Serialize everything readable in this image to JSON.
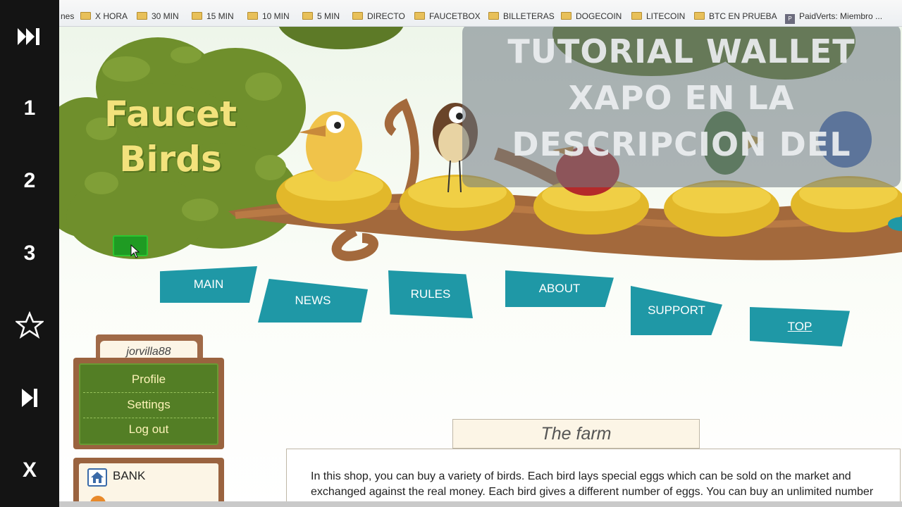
{
  "rail": {
    "items": [
      {
        "name": "fast-forward-icon",
        "glyph": "⏭"
      },
      {
        "name": "rail-item-1",
        "label": "1"
      },
      {
        "name": "rail-item-2",
        "label": "2"
      },
      {
        "name": "rail-item-3",
        "label": "3"
      },
      {
        "name": "star-icon",
        "glyph": "☆"
      },
      {
        "name": "next-icon",
        "glyph": "⏭"
      },
      {
        "name": "close-icon",
        "glyph": "X"
      }
    ]
  },
  "bookmarks": {
    "items": [
      "nes",
      "X HORA",
      "30 MIN",
      "15 MIN",
      "10 MIN",
      "5 MIN",
      "DIRECTO",
      "FAUCETBOX",
      "BILLETERAS",
      "DOGECOIN",
      "LITECOIN",
      "BTC EN PRUEBA",
      "PaidVerts: Miembro ..."
    ]
  },
  "overlay": {
    "lines": [
      "TUTORIAL WALLET",
      "XAPO EN LA",
      "DESCRIPCION DEL"
    ]
  },
  "logo": {
    "line1": "Faucet",
    "line2": "Birds"
  },
  "nav": {
    "main": "MAIN",
    "news": "NEWS",
    "rules": "RULES",
    "about": "ABOUT",
    "support": "SUPPORT",
    "top": "TOP"
  },
  "user": {
    "name": "jorvilla88",
    "menu": [
      "Profile",
      "Settings",
      "Log out"
    ]
  },
  "bank": {
    "label": "BANK"
  },
  "farm": {
    "title": "The farm",
    "text": "In this shop, you can buy a variety of birds. Each bird lays special eggs which can be sold on the market and exchanged against the real money. Each bird gives a different number of eggs. You can buy an unlimited number of times, our magical birds do not die (if you keep feeding them) and will always give"
  },
  "colors": {
    "nav_teal": "#1f98a6",
    "menu_green": "#537e25",
    "wood": "#9a633f",
    "logo_yellow": "#f3e27c"
  }
}
